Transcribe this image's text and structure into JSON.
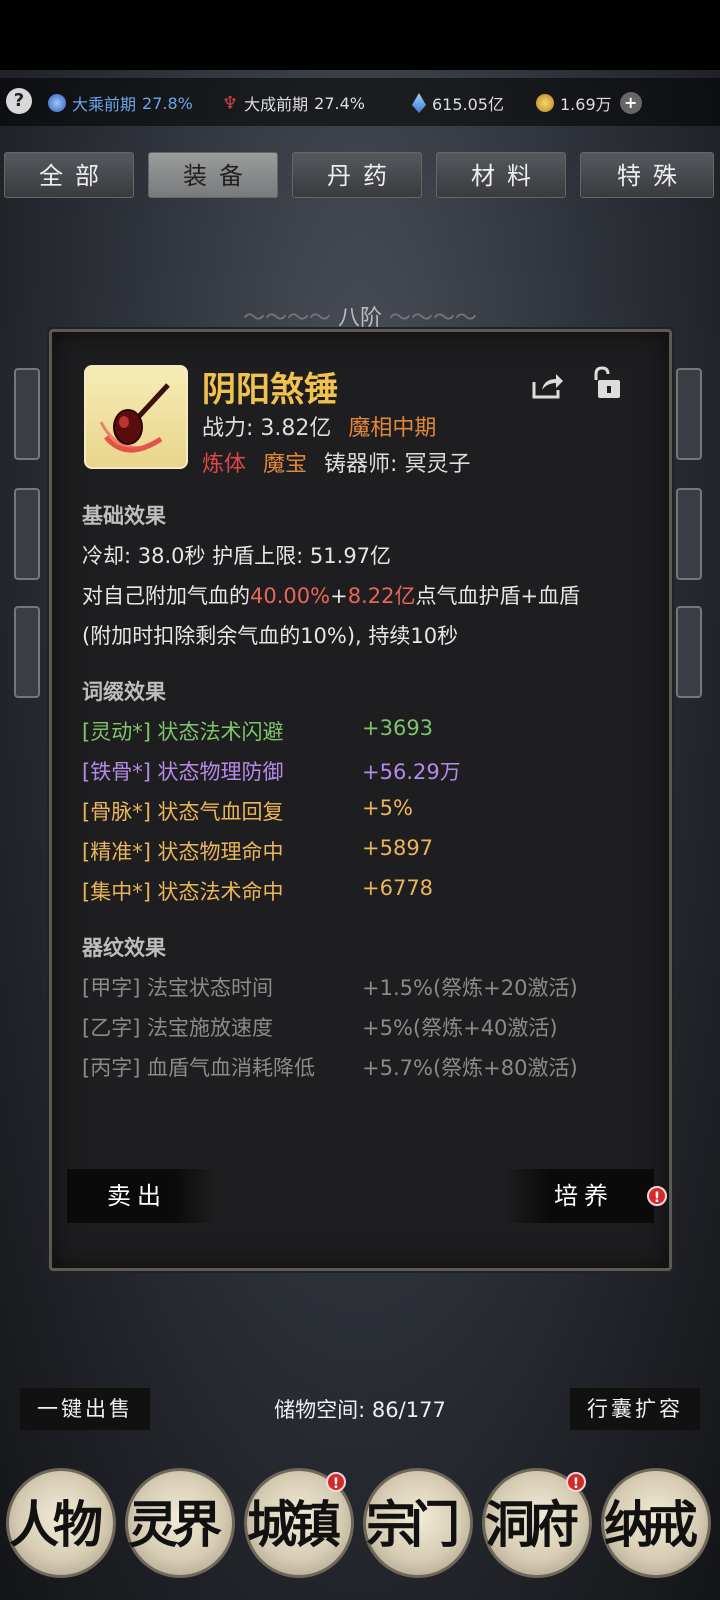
{
  "resources": [
    {
      "icon": "realm-orb-icon",
      "label": "大乘前期",
      "value": "27.8%"
    },
    {
      "icon": "body-cultivation-icon",
      "label": "大成前期",
      "value": "27.4%"
    },
    {
      "icon": "spirit-crystal-icon",
      "value": "615.05亿"
    },
    {
      "icon": "gold-coin-icon",
      "value": "1.69万"
    }
  ],
  "help_label": "?",
  "tabs": [
    "全部",
    "装备",
    "丹药",
    "材料",
    "特殊"
  ],
  "active_tab": "装备",
  "tier_label": "八阶",
  "item": {
    "name": "阴阳煞锤",
    "power_label": "战力:",
    "power_value": "3.82亿",
    "realm": "魔相中期",
    "tag1": "炼体",
    "tag2": "魔宝",
    "smith_label": "铸器师:",
    "smith_name": "冥灵子"
  },
  "basic": {
    "title": "基础效果",
    "line1": "冷却: 38.0秒 护盾上限: 51.97亿",
    "line2_pre": "对自己附加气血的",
    "line2_pct": "40.00%",
    "line2_plus": "+",
    "line2_val": "8.22亿",
    "line2_post": "点气血护盾+血盾",
    "line3": "(附加时扣除剩余气血的10%), 持续10秒"
  },
  "affix": {
    "title": "词缀效果",
    "rows": [
      {
        "name": "[灵动*] 状态法术闪避",
        "value": "+3693",
        "color": "#7fc46a"
      },
      {
        "name": "[铁骨*] 状态物理防御",
        "value": "+56.29万",
        "color": "#b48be6"
      },
      {
        "name": "[骨脉*] 状态气血回复",
        "value": "+5%",
        "color": "#e9b55a"
      },
      {
        "name": "[精准*] 状态物理命中",
        "value": "+5897",
        "color": "#e9b55a"
      },
      {
        "name": "[集中*] 状态法术命中",
        "value": "+6778",
        "color": "#e9b55a"
      }
    ]
  },
  "pattern": {
    "title": "器纹效果",
    "rows": [
      {
        "name": "[甲字] 法宝状态时间",
        "value": "+1.5%(祭炼+20激活)"
      },
      {
        "name": "[乙字] 法宝施放速度",
        "value": "+5%(祭炼+40激活)"
      },
      {
        "name": "[丙字] 血盾气血消耗降低",
        "value": "+5.7%(祭炼+80激活)"
      }
    ]
  },
  "buttons": {
    "sell": "卖出",
    "cultivate": "培养",
    "alert": "!"
  },
  "bottom": {
    "sell_all": "一键出售",
    "storage": "储物空间: 86/177",
    "expand": "行囊扩容"
  },
  "nav": [
    "人物",
    "灵界",
    "城镇",
    "宗门",
    "洞府",
    "纳戒"
  ],
  "colors": {
    "gold": "#f2c24e",
    "orange": "#e1873a",
    "red": "#e04646",
    "green": "#7fc46a",
    "purple": "#b48be6",
    "yellow": "#e9b55a"
  }
}
